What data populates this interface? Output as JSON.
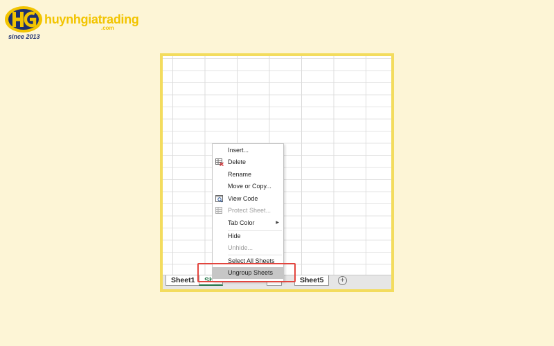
{
  "logo": {
    "initials": "HG",
    "brand": "huynhgiatrading",
    "domain_suffix": ".com",
    "tagline": "since 2013"
  },
  "colors": {
    "page_background": "#fdf5d6",
    "frame_border": "#f3dc5e",
    "highlight_box": "#e3453e",
    "active_tab_text": "#1f7244",
    "brand_yellow": "#f2c400",
    "brand_blue": "#1d2f6f"
  },
  "sheet_tabs": [
    {
      "label": "Sheet1",
      "icon": null
    },
    {
      "label": "She",
      "icon": null
    },
    {
      "label": "4",
      "icon": null
    },
    {
      "label": "Sheet5",
      "icon": null
    }
  ],
  "add_sheet_button": {
    "icon": "plus-circle-icon",
    "glyph": "+"
  },
  "context_menu": {
    "items": [
      {
        "label": "Insert...",
        "icon": null,
        "disabled": false
      },
      {
        "label": "Delete",
        "icon": "delete-sheet-icon",
        "disabled": false
      },
      {
        "label": "Rename",
        "icon": null,
        "disabled": false
      },
      {
        "label": "Move or Copy...",
        "icon": null,
        "disabled": false
      },
      {
        "label": "View Code",
        "icon": "view-code-icon",
        "disabled": false
      },
      {
        "label": "Protect Sheet...",
        "icon": "protect-sheet-icon",
        "disabled": true
      },
      {
        "label": "Tab Color",
        "icon": null,
        "disabled": false,
        "submenu": true,
        "submenu_glyph": "▶"
      },
      {
        "label": "Hide",
        "icon": null,
        "disabled": false
      },
      {
        "label": "Unhide...",
        "icon": null,
        "disabled": true
      },
      {
        "label": "Select All Sheets",
        "icon": null,
        "disabled": false
      },
      {
        "label": "Ungroup Sheets",
        "icon": null,
        "disabled": false,
        "highlighted": true
      }
    ]
  }
}
